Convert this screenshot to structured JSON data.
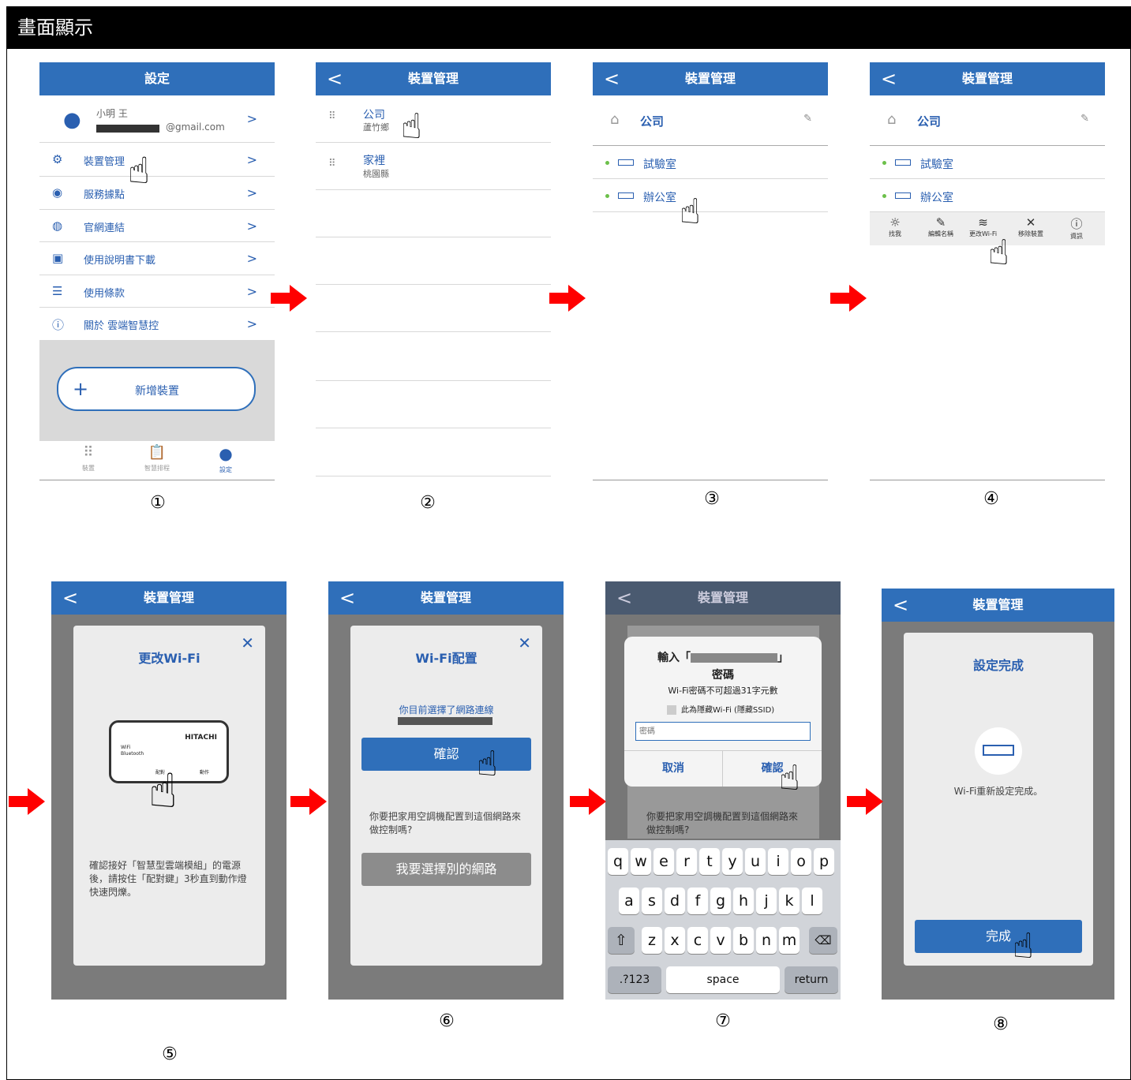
{
  "title": "畫面顯示",
  "steps": [
    "①",
    "②",
    "③",
    "④",
    "⑤",
    "⑥",
    "⑦",
    "⑧"
  ],
  "s1": {
    "header": "設定",
    "user_name": "小明 王",
    "user_email": "@gmail.com",
    "menu": [
      "裝置管理",
      "服務據點",
      "官網連結",
      "使用說明書下載",
      "使用條款",
      "關於 雲端智慧控"
    ],
    "add_device": "新增裝置",
    "tabs": [
      "裝置",
      "智慧排程",
      "設定"
    ]
  },
  "s2": {
    "header": "裝置管理",
    "groups": [
      {
        "name": "公司",
        "sub": "蘆竹鄉"
      },
      {
        "name": "家裡",
        "sub": "桃園縣"
      }
    ]
  },
  "s3": {
    "header": "裝置管理",
    "group": "公司",
    "rooms": [
      "試驗室",
      "辦公室"
    ]
  },
  "s4": {
    "header": "裝置管理",
    "group": "公司",
    "rooms": [
      "試驗室",
      "辦公室"
    ],
    "actions": [
      "找我",
      "編輯名稱",
      "更改Wi-Fi",
      "移除裝置",
      "資訊"
    ]
  },
  "s5": {
    "header": "裝置管理",
    "modal_title": "更改Wi-Fi",
    "brand": "HITACHI",
    "dev_wifi": "WiFi",
    "dev_bt": "Bluetooth",
    "dev_pair": "配對",
    "dev_act": "動作",
    "text": "確認接好「智慧型雲端模組」的電源後，請按住「配對鍵」3秒直到動作燈快速閃爍。"
  },
  "s6": {
    "header": "裝置管理",
    "modal_title": "Wi-Fi配置",
    "selected": "你目前選擇了網路連線",
    "confirm": "確認",
    "question": "你要把家用空調機配置到這個網路來做控制嗎?",
    "other": "我要選擇別的網路"
  },
  "s7": {
    "header": "裝置管理",
    "prompt_a": "輸入「",
    "prompt_b": "」",
    "prompt_c": "密碼",
    "limit": "Wi-Fi密碼不可超過31字元數",
    "hidden": "此為隱藏Wi-Fi (隱藏SSID)",
    "placeholder": "密碼",
    "cancel": "取消",
    "confirm": "確認",
    "behind": "你要把家用空調機配置到這個網路來做控制嗎?",
    "row1": [
      "q",
      "w",
      "e",
      "r",
      "t",
      "y",
      "u",
      "i",
      "o",
      "p"
    ],
    "row2": [
      "a",
      "s",
      "d",
      "f",
      "g",
      "h",
      "j",
      "k",
      "l"
    ],
    "row3": [
      "z",
      "x",
      "c",
      "v",
      "b",
      "n",
      "m"
    ],
    "k123": ".?123",
    "space": "space",
    "ret": "return"
  },
  "s8": {
    "header": "裝置管理",
    "modal_title": "設定完成",
    "msg": "Wi-Fi重新設定完成。",
    "done": "完成"
  },
  "colors": {
    "blue": "#2f6fba",
    "arrow": "#ff0000"
  }
}
